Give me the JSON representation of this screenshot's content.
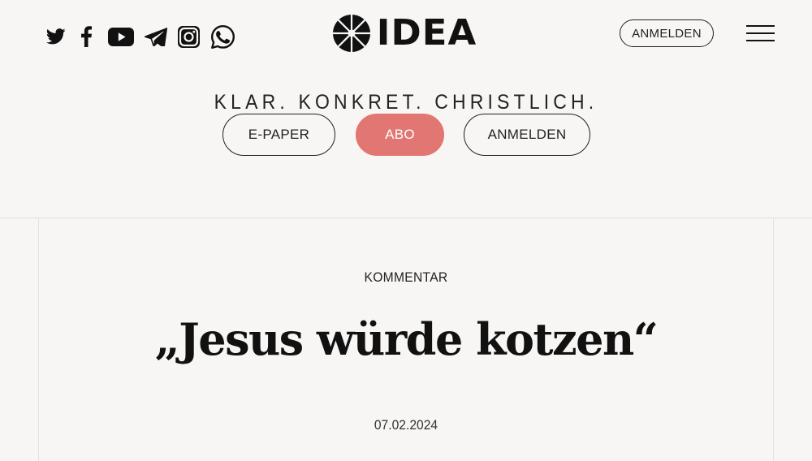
{
  "header": {
    "social_icons": [
      "twitter-icon",
      "facebook-icon",
      "youtube-icon",
      "telegram-icon",
      "instagram-icon",
      "whatsapp-icon"
    ],
    "logo_text": "IDEA",
    "login_label": "ANMELDEN",
    "menu_icon": "hamburger-menu-icon",
    "slogan": "KLAR. KONKRET. CHRISTLICH.",
    "cta": {
      "epaper_label": "E-PAPER",
      "abo_label": "ABO",
      "login_label": "ANMELDEN"
    }
  },
  "colors": {
    "background": "#f8f6f4",
    "accent": "#e27672",
    "text": "#111111"
  },
  "article": {
    "category": "KOMMENTAR",
    "title": "„Jesus würde kotzen“",
    "date": "07.02.2024"
  }
}
